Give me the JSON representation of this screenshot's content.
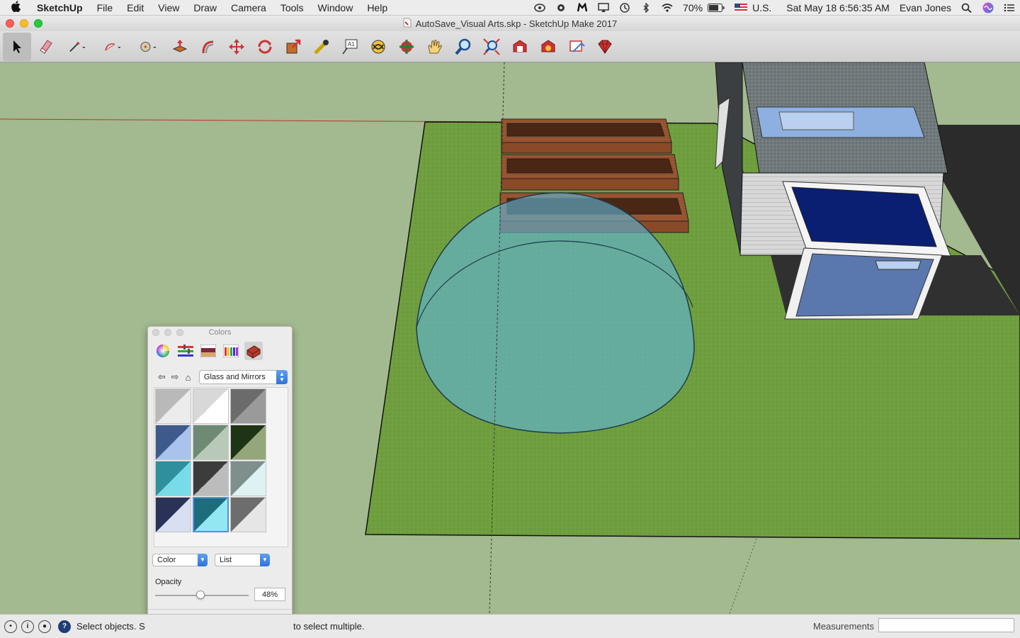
{
  "menubar": {
    "apple_icon": "apple-icon",
    "app_name": "SketchUp",
    "menus": [
      "File",
      "Edit",
      "View",
      "Draw",
      "Camera",
      "Tools",
      "Window",
      "Help"
    ],
    "battery": "70%",
    "input_source": "U.S.",
    "datetime": "Sat May 18  6:56:35 AM",
    "user": "Evan Jones"
  },
  "window": {
    "title": "AutoSave_Visual Arts.skp - SketchUp Make 2017"
  },
  "toolbar": {
    "tools": [
      "select",
      "eraser",
      "line",
      "arc",
      "paint-bucket",
      "push-pull",
      "offset",
      "move",
      "rotate",
      "scale",
      "tape-measure",
      "text",
      "orbit",
      "pan",
      "walk",
      "zoom",
      "zoom-extents",
      "warehouse",
      "extension-warehouse",
      "layout",
      "ruby"
    ]
  },
  "colors_panel": {
    "title": "Colors",
    "library": "Glass and Mirrors",
    "display_mode": "Color",
    "view_mode": "List",
    "opacity_label": "Opacity",
    "opacity_value": "48%",
    "opacity_fraction": 0.48,
    "swatches": [
      [
        "#b9b9b9",
        "#ececec"
      ],
      [
        "#d8d8d8",
        "#ffffff"
      ],
      [
        "#6b6b6b",
        "#9a9a9a"
      ],
      [
        "#3e5a8c",
        "#a9c3ec"
      ],
      [
        "#6f8a74",
        "#b8c9b9"
      ],
      [
        "#1f3414",
        "#94a67a"
      ],
      [
        "#2f8f9c",
        "#78dbe8"
      ],
      [
        "#3c3c3c",
        "#bcbcbc"
      ],
      [
        "#7e8f8c",
        "#dff2f3"
      ],
      [
        "#2a3357",
        "#d7dff0"
      ],
      [
        "#1e6c7c",
        "#93e7f2"
      ],
      [
        "#6d6d6d",
        "#e6e6e6"
      ]
    ],
    "selected_swatch": 10,
    "current_color": [
      "#2a6f85",
      "#8fd7e6"
    ]
  },
  "statusbar": {
    "hint_left": "Select objects. S",
    "hint_right": "to select multiple.",
    "measurements_label": "Measurements",
    "measurements_value": ""
  }
}
